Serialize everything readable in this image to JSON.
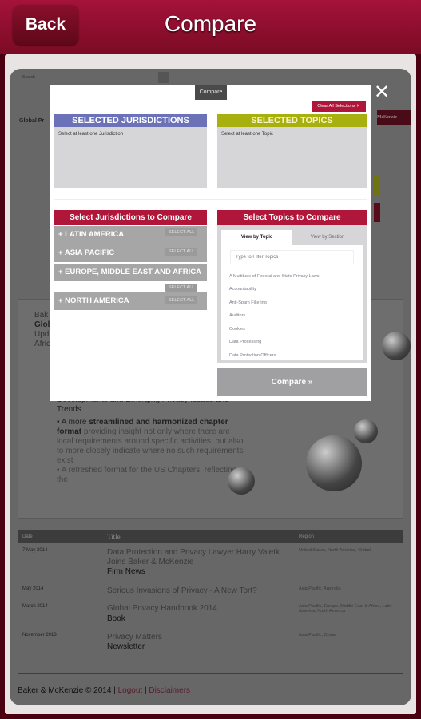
{
  "header": {
    "back_label": "Back",
    "title": "Compare"
  },
  "background": {
    "search_label": "Search",
    "tab_label": "Global Pr",
    "brand_fragment": "McKenzie",
    "intro_fragments": [
      "Bak",
      "Glol",
      "Upd",
      "Afric"
    ],
    "bullet_tail": "Developments and Emerging Privacy Issues and Trends",
    "bullet2_bold": "streamlined and harmonized chapter format",
    "bullet2_pre": "A more ",
    "bullet2_rest": "providing insight not only where there are local requirements around specific activities, but also to more closely indicate where no such requirements exist",
    "bullet3": "A refreshed format for the US Chapters, reflecting the",
    "table": {
      "headers": [
        "Date",
        "Title",
        "Region"
      ],
      "rows": [
        {
          "date": "7 May 2014",
          "title": "Data Protection and Privacy Lawyer Harry Valetk Joins Baker & McKenzie",
          "type": "Firm News",
          "region": "United States, North America, Global"
        },
        {
          "date": "May 2014",
          "title": "Serious Invasions of Privacy - A New Tort?",
          "type": "",
          "region": "Asia Pacific, Australia"
        },
        {
          "date": "March 2014",
          "title": "Global Privacy Handbook 2014",
          "type": "Book",
          "region": "Asia Pacific, Europe, Middle East & Africa, Latin America, North America"
        },
        {
          "date": "November 2013",
          "title": "Privacy Matters",
          "type": "Newsletter",
          "region": "Asia Pacific, China"
        }
      ]
    },
    "footer": {
      "copyright": "Baker & McKenzie © 2014 |",
      "logout": "Logout",
      "sep": "|",
      "disclaimers": "Disclaimers"
    }
  },
  "modal": {
    "tab_label": "Compare",
    "close_icon": "close-icon",
    "clear_all_label": "Clear All Selections ✕",
    "selected_jurisdictions": {
      "title": "SELECTED JURISDICTIONS",
      "placeholder": "Select at least one Jurisdiction",
      "color": "#6b72b8"
    },
    "selected_topics": {
      "title": "SELECTED TOPICS",
      "placeholder": "Select at least one Topic",
      "color": "#a8b010"
    },
    "jurisdictions": {
      "title": "Select Jurisdictions to Compare",
      "select_all": "SELECT ALL",
      "regions": [
        "+ LATIN AMERICA",
        "+ ASIA PACIFIC",
        "+ EUROPE, MIDDLE EAST AND AFRICA",
        "+ NORTH AMERICA"
      ]
    },
    "topics": {
      "title": "Select Topics to Compare",
      "tabs": [
        "View by Topic",
        "View by Section"
      ],
      "active_tab": "View by Topic",
      "filter_placeholder": "Type to Filter Topics",
      "items": [
        "A Multitude of Federal and State Privacy Laws",
        "Accountability",
        "Anti-Spam Filtering",
        "Auditors",
        "Cookies",
        "Data Processing",
        "Data Protection Officers"
      ]
    },
    "compare_button": "Compare »",
    "accent": "#b0163a"
  }
}
